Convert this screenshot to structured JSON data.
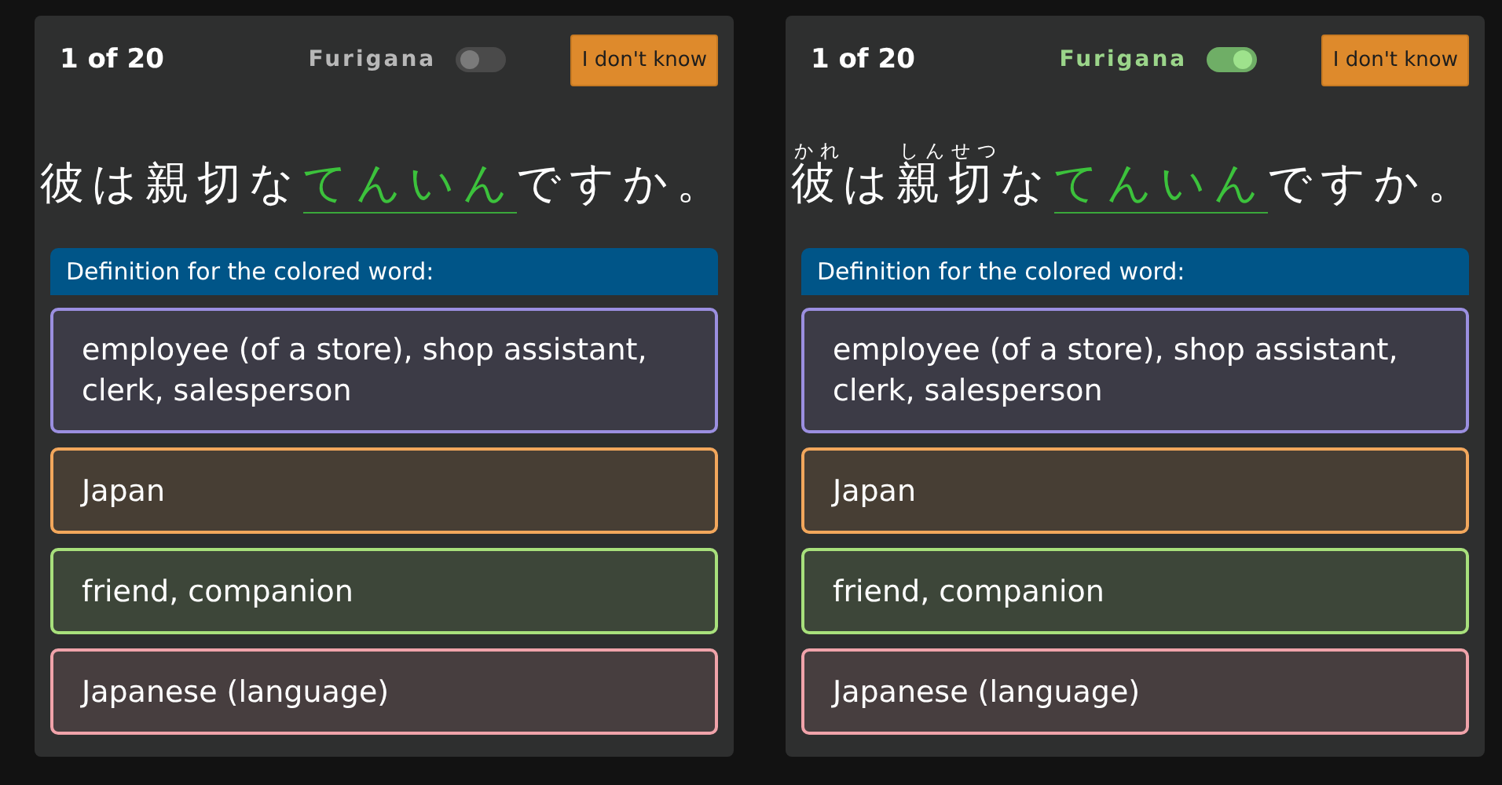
{
  "panels": [
    {
      "counter": "1 of 20",
      "furigana": {
        "label": "Furigana",
        "on": false
      },
      "skip_button": "I don't know",
      "sentence": [
        {
          "text": "彼",
          "highlighted": false
        },
        {
          "text": "は",
          "highlighted": false
        },
        {
          "text": "親切",
          "highlighted": false
        },
        {
          "text": "な",
          "highlighted": false
        },
        {
          "text": "てんいん",
          "highlighted": true
        },
        {
          "text": "ですか。",
          "highlighted": false
        }
      ],
      "definition_header": "Definition for the colored word:",
      "options": [
        {
          "text": "employee (of a store), shop assistant, clerk, salesperson",
          "color": "#9b8fe0"
        },
        {
          "text": "Japan",
          "color": "#f2a75c"
        },
        {
          "text": "friend, companion",
          "color": "#a8e07c"
        },
        {
          "text": "Japanese (language)",
          "color": "#f0a3aa"
        }
      ]
    },
    {
      "counter": "1 of 20",
      "furigana": {
        "label": "Furigana",
        "on": true
      },
      "skip_button": "I don't know",
      "sentence": [
        {
          "text": "彼",
          "ruby": "かれ",
          "highlighted": false
        },
        {
          "text": "は",
          "highlighted": false
        },
        {
          "text": "親切",
          "ruby": "しんせつ",
          "highlighted": false
        },
        {
          "text": "な",
          "highlighted": false
        },
        {
          "text": "てんいん",
          "highlighted": true
        },
        {
          "text": "ですか。",
          "highlighted": false
        }
      ],
      "definition_header": "Definition for the colored word:",
      "options": [
        {
          "text": "employee (of a store), shop assistant, clerk, salesperson",
          "color": "#9b8fe0"
        },
        {
          "text": "Japan",
          "color": "#f2a75c"
        },
        {
          "text": "friend, companion",
          "color": "#a8e07c"
        },
        {
          "text": "Japanese (language)",
          "color": "#f0a3aa"
        }
      ]
    }
  ]
}
